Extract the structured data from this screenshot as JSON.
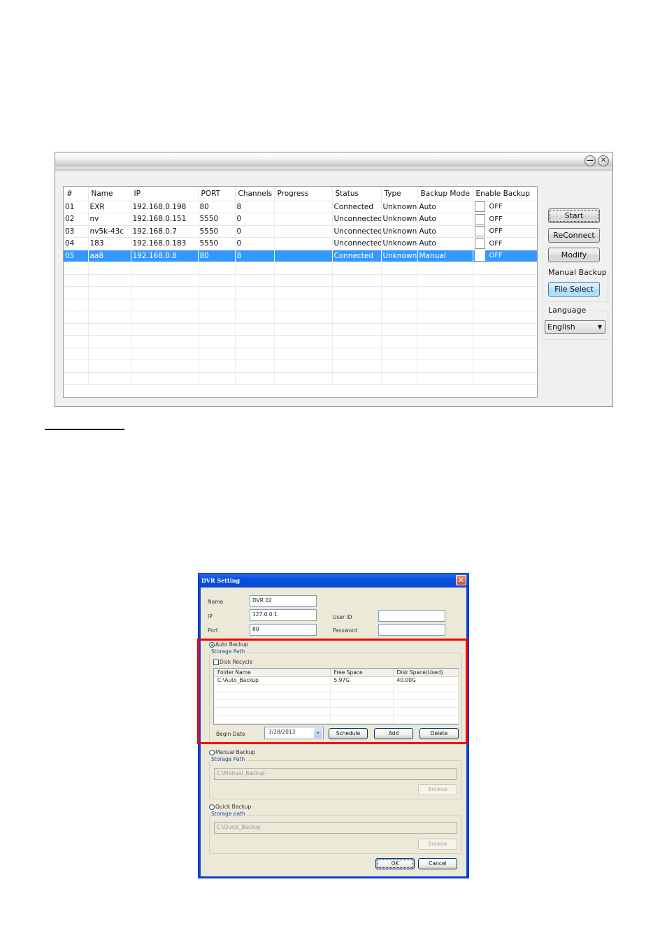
{
  "main_window": {
    "title_buttons": {
      "minimize": "—",
      "close": "✕"
    },
    "columns": [
      "#",
      "Name",
      "IP",
      "PORT",
      "Channels",
      "Progress",
      "Status",
      "Type",
      "Backup Mode",
      "Enable Backup"
    ],
    "rows": [
      {
        "num": "01",
        "name": "EXR",
        "ip": "192.168.0.198",
        "port": "80",
        "channels": "8",
        "progress": "",
        "status": "Connected",
        "type": "Unknown",
        "backup_mode": "Auto",
        "enable_backup": "OFF",
        "selected": false
      },
      {
        "num": "02",
        "name": "nv",
        "ip": "192.168.0.151",
        "port": "5550",
        "channels": "0",
        "progress": "",
        "status": "Unconnected",
        "type": "Unknown",
        "backup_mode": "Auto",
        "enable_backup": "OFF",
        "selected": false
      },
      {
        "num": "03",
        "name": "nv5k-43c",
        "ip": "192.168.0.7",
        "port": "5550",
        "channels": "0",
        "progress": "",
        "status": "Unconnected",
        "type": "Unknown",
        "backup_mode": "Auto",
        "enable_backup": "OFF",
        "selected": false
      },
      {
        "num": "04",
        "name": "183",
        "ip": "192.168.0.183",
        "port": "5550",
        "channels": "0",
        "progress": "",
        "status": "Unconnected",
        "type": "Unknown",
        "backup_mode": "Auto",
        "enable_backup": "OFF",
        "selected": false
      },
      {
        "num": "05",
        "name": "aa8",
        "ip": "192.168.0.8",
        "port": "80",
        "channels": "8",
        "progress": "",
        "status": "Connected",
        "type": "Unknown",
        "backup_mode": "Manual",
        "enable_backup": "OFF",
        "selected": true
      }
    ],
    "empty_rows": 10,
    "buttons": {
      "start": "Start",
      "reconnect": "ReConnect",
      "modify": "Modify"
    },
    "manual_backup": {
      "label": "Manual Backup",
      "file_select": "File Select"
    },
    "language": {
      "label": "Language",
      "selected": "English",
      "arrow": "▼"
    },
    "selection_color": "#3399ff"
  },
  "dvr_setting": {
    "title": "DVR Setting",
    "close_glyph": "✕",
    "name_label": "Name",
    "name_value": "DVR 02",
    "ip_label": "IP",
    "ip_value": "127.0.0.1",
    "port_label": "Port",
    "port_value": "80",
    "userid_label": "User ID",
    "userid_value": "",
    "password_label": "Password",
    "password_value": "",
    "auto_backup": {
      "label": "Auto Backup",
      "selected": true,
      "storage_path_label": "Storage Path",
      "disk_recycle_label": "Disk Recycle",
      "disk_recycle_checked": false,
      "columns": [
        "Folder Name",
        "Free Space",
        "Disk Space(Used)"
      ],
      "rows": [
        {
          "folder": "C:\\Auto_Backup",
          "free": "5.97G",
          "used": "40.00G"
        }
      ],
      "empty_rows": 5,
      "begin_date_label": "Begin Date",
      "begin_date_value": "3/28/2013",
      "schedule_button": "Schedule",
      "add_button": "Add",
      "delete_button": "Delete"
    },
    "manual_backup": {
      "label": "Manual Backup",
      "selected": false,
      "storage_path_label": "Storage Path",
      "path_value": "C:\\Manual_Backup",
      "browse_button": "Browse"
    },
    "quick_backup": {
      "label": "Quick Backup",
      "selected": false,
      "storage_path_label": "Storage path",
      "path_value": "C:\\Quick_Backup",
      "browse_button": "Browse"
    },
    "ok_button": "OK",
    "cancel_button": "Cancel",
    "highlight_color": "#ff0000"
  }
}
